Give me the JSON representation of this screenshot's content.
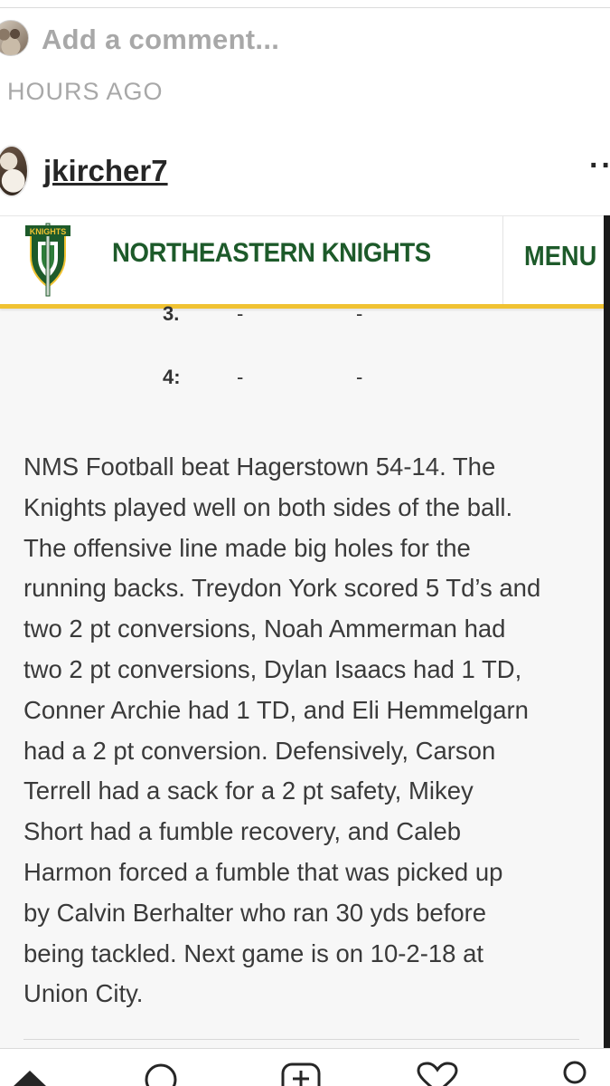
{
  "comment": {
    "placeholder": "Add a comment..."
  },
  "time_ago": "HOURS AGO",
  "post": {
    "username": "jkircher7",
    "more_icon": "more-dots-icon"
  },
  "site": {
    "title": "NORTHEASTERN KNIGHTS",
    "logo_text": "KNIGHTS",
    "menu_label": "MENU",
    "colors": {
      "green": "#1d5a2a",
      "gold": "#f0c232"
    }
  },
  "scores": [
    {
      "quarter": "3.",
      "home": "-",
      "away": "-"
    },
    {
      "quarter": "4:",
      "home": "-",
      "away": "-"
    }
  ],
  "article": {
    "lines": [
      "NMS Football beat Hagerstown 54-14. The",
      "Knights played well on both sides of the ball.",
      "The offensive line made big holes for the",
      "running backs. Treydon York scored 5 Td’s and",
      "two 2 pt conversions, Noah Ammerman had",
      "two 2 pt conversions, Dylan Isaacs had 1 TD,",
      "Conner Archie had 1 TD, and Eli Hemmelgarn",
      "had a 2 pt conversion. Defensively, Carson",
      "Terrell had a sack for a 2 pt safety, Mikey",
      "Short had a fumble recovery, and Caleb",
      "Harmon forced a fumble that was picked up",
      "by Calvin Berhalter who ran 30 yds before",
      "being tackled. Next game is on 10-2-18 at",
      "Union City."
    ]
  },
  "bottom_nav": [
    "home-icon",
    "search-icon",
    "new-post-icon",
    "activity-heart-icon",
    "profile-icon"
  ]
}
